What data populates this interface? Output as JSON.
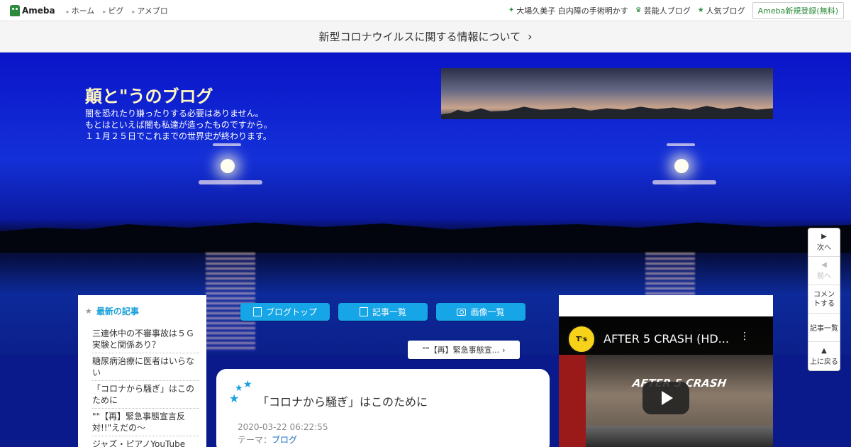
{
  "topbar": {
    "logo_text": "Ameba",
    "nav": [
      "ホーム",
      "ピグ",
      "アメブロ"
    ],
    "right_links": [
      {
        "icon": "sparkle-icon",
        "glyph": "✦",
        "label": "大場久美子 白内障の手術明かす"
      },
      {
        "icon": "crown-icon",
        "glyph": "♛",
        "label": "芸能人ブログ"
      },
      {
        "icon": "star-icon",
        "glyph": "★",
        "label": "人気ブログ"
      }
    ],
    "register_label": "Ameba新規登録(無料)"
  },
  "notice": {
    "text": "新型コロナウイルスに関する情報について",
    "chevron": "›"
  },
  "blog": {
    "title": "顛と\"うのブログ",
    "description": [
      "闇を恐れたり嫌ったりする必要はありません。",
      "もとはといえば闇も私達が造ったものですから。",
      "１１月２５日でこれまでの世界史が終わります。"
    ]
  },
  "sidebar": {
    "heading_icon": "★",
    "heading": "最新の記事",
    "items": [
      "三連休中の不審事故は５Ｇ実験と関係あり？",
      "糖尿病治療に医者はいらない",
      "「コロナから騒ぎ」はこのために",
      "\"\"【再】緊急事態宣言反対!!\"えだの～",
      "ジャズ・ピアノYouTube"
    ]
  },
  "buttons": {
    "blog_top": "ブログトップ",
    "article_list": "記事一覧",
    "image_list": "画像一覧"
  },
  "next_article": {
    "label": "\"\"【再】緊急事態宣...",
    "chevron": "›"
  },
  "article": {
    "title": "「コロナから騒ぎ」はこのために",
    "date": "2020-03-22 06:22:55",
    "theme_label": "テーマ：",
    "theme_value": "ブログ"
  },
  "video": {
    "channel_badge": "T's",
    "title": "AFTER 5 CRASH (HD...",
    "overlay_text": "AFTER 5 CRASH",
    "menu_glyph": "⋮"
  },
  "right_nav": [
    {
      "arrow": "▶",
      "label": "次へ",
      "disabled": false
    },
    {
      "arrow": "◀",
      "label": "前へ",
      "disabled": true
    },
    {
      "arrow": "",
      "label": "コメントする",
      "disabled": false
    },
    {
      "arrow": "",
      "label": "記事一覧",
      "disabled": false
    },
    {
      "arrow": "▲",
      "label": "上に戻る",
      "disabled": false
    }
  ],
  "colors": {
    "accent_blue": "#16a5e6",
    "ameba_green": "#2d8c3c",
    "hero_blue": "#1430d8"
  }
}
